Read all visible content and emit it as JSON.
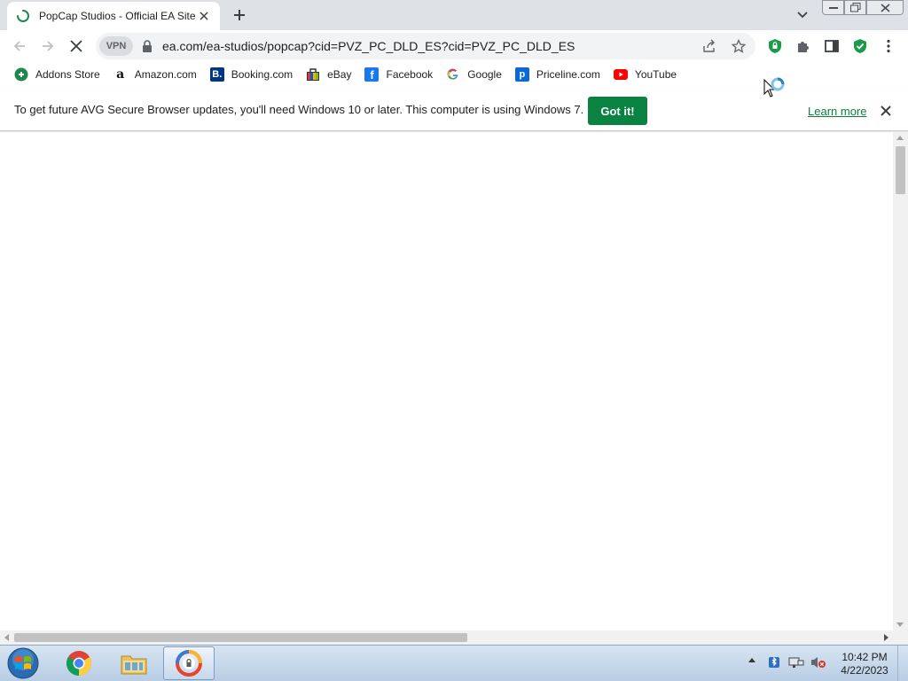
{
  "browser": {
    "tab": {
      "title": "PopCap Studios - Official EA Site",
      "loading": true
    },
    "address_bar": {
      "vpn_label": "VPN",
      "url": "ea.com/ea-studios/popcap?cid=PVZ_PC_DLD_ES?cid=PVZ_PC_DLD_ES"
    },
    "bookmarks": [
      {
        "label": "Addons Store",
        "icon": "addons-store-icon"
      },
      {
        "label": "Amazon.com",
        "icon": "amazon-icon"
      },
      {
        "label": "Booking.com",
        "icon": "booking-icon"
      },
      {
        "label": "eBay",
        "icon": "ebay-icon"
      },
      {
        "label": "Facebook",
        "icon": "facebook-icon"
      },
      {
        "label": "Google",
        "icon": "google-icon"
      },
      {
        "label": "Priceline.com",
        "icon": "priceline-icon"
      },
      {
        "label": "YouTube",
        "icon": "youtube-icon"
      }
    ],
    "infobar": {
      "message": "To get future AVG Secure Browser updates, you'll need Windows 10 or later. This computer is using Windows 7.",
      "button": "Got it!",
      "link": "Learn more"
    }
  },
  "taskbar": {
    "apps": [
      "chrome-icon",
      "file-explorer-icon",
      "avg-secure-browser-icon"
    ],
    "clock": {
      "time": "10:42 PM",
      "date": "4/22/2023"
    }
  },
  "colors": {
    "accent_green": "#0a8342",
    "tab_strip": "#dee1e6",
    "omnibox": "#f1f3f4",
    "taskbar": "#c6d8ec"
  }
}
